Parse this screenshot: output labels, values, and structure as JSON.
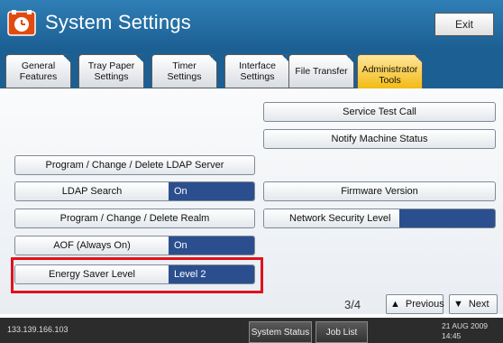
{
  "header": {
    "title": "System Settings",
    "exit_label": "Exit"
  },
  "tabs": [
    {
      "label": "General Features",
      "active": false
    },
    {
      "label": "Tray Paper Settings",
      "active": false
    },
    {
      "label": "Timer Settings",
      "active": false
    },
    {
      "label": "Interface Settings",
      "active": false
    },
    {
      "label": "File Transfer",
      "active": false
    },
    {
      "label": "Administrator Tools",
      "active": true
    }
  ],
  "buttons": {
    "service_test_call": "Service Test Call",
    "notify_machine_status": "Notify Machine Status",
    "program_ldap": "Program / Change / Delete LDAP Server",
    "ldap_search": "LDAP Search",
    "ldap_search_value": "On",
    "firmware_version": "Firmware Version",
    "program_realm": "Program / Change / Delete Realm",
    "network_security_level": "Network Security Level",
    "network_security_value": "",
    "aof": "AOF (Always On)",
    "aof_value": "On",
    "energy_saver_level": "Energy Saver Level",
    "energy_saver_value": "Level 2"
  },
  "pagination": {
    "page": "3/4",
    "previous": "Previous",
    "next": "Next"
  },
  "footer": {
    "ip": "133.139.166.103",
    "system_status": "System Status",
    "job_list": "Job List",
    "date": "21 AUG 2009",
    "time": "14:45"
  },
  "colors": {
    "accent_blue": "#1c5f93",
    "value_blue": "#2b4f8e",
    "highlight_red": "#e0121c",
    "active_tab": "#f0b400"
  }
}
